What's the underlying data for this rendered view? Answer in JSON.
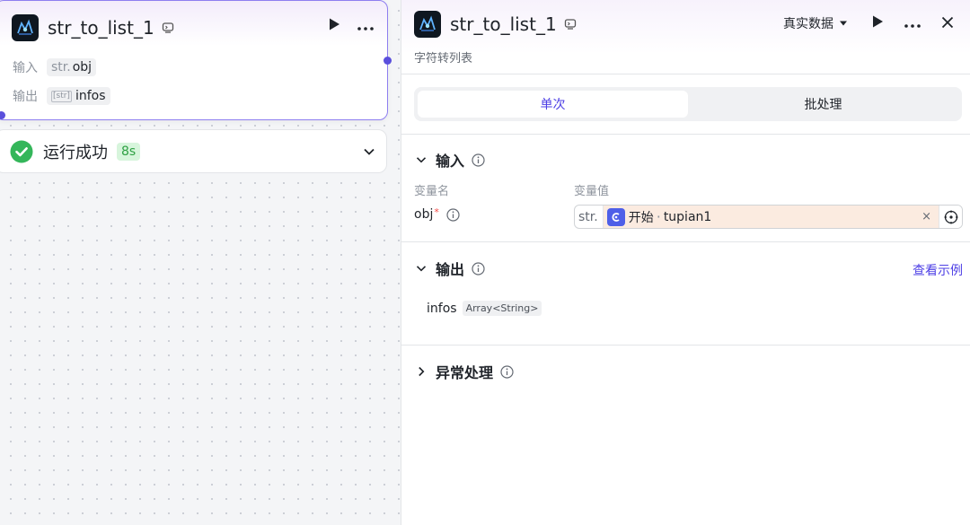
{
  "canvas": {
    "node": {
      "title": "str_to_list_1",
      "input_label": "输入",
      "input_type": "str.",
      "input_name": "obj",
      "output_label": "输出",
      "output_type_icon": "[str]",
      "output_name": "infos"
    },
    "status": {
      "text": "运行成功",
      "time": "8s"
    }
  },
  "panel": {
    "title": "str_to_list_1",
    "subtitle": "字符转列表",
    "data_select_label": "真实数据",
    "tabs": {
      "single": "单次",
      "batch": "批处理"
    },
    "input_section": {
      "title": "输入",
      "col_name": "变量名",
      "col_value": "变量值",
      "var_name": "obj",
      "required_mark": "*",
      "value_type": "str.",
      "ref_node": "开始",
      "ref_sep": "·",
      "ref_var": "tupian1",
      "clear_symbol": "×"
    },
    "output_section": {
      "title": "输出",
      "example_link": "查看示例",
      "var_name": "infos",
      "var_type": "Array<String>"
    },
    "error_section": {
      "title": "异常处理"
    }
  },
  "colors": {
    "accent": "#4e40e5",
    "success": "#2ea043",
    "node_border": "#8e7ef0",
    "ref_bg": "#fbebe0"
  },
  "icons": [
    "app-icon",
    "preview-icon",
    "play-icon",
    "more-icon",
    "check-circle-icon",
    "chevron-down-icon",
    "close-icon",
    "info-icon",
    "chevron-right-icon",
    "target-icon",
    "start-node-icon"
  ]
}
